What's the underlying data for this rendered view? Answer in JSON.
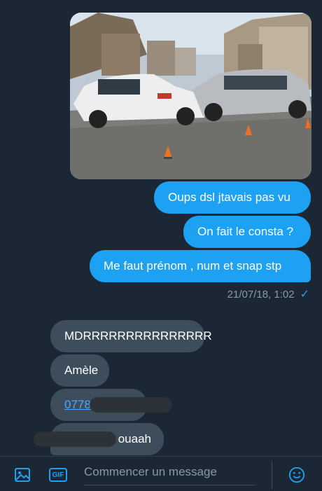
{
  "messages_out": [
    {
      "text": "Oups dsl jtavais pas vu"
    },
    {
      "text": "On fait le consta ?"
    },
    {
      "text": "Me faut prénom , num et snap stp"
    }
  ],
  "timestamp": "21/07/18, 1:02",
  "messages_in": [
    {
      "text": "MDRRRRRRRRRRRRRRR"
    },
    {
      "text": "Amèle"
    },
    {
      "text": "0778"
    },
    {
      "text": "ouaah"
    }
  ],
  "composer": {
    "placeholder": "Commencer un message",
    "gif_label": "GIF"
  },
  "colors": {
    "background": "#1b2734",
    "outgoing_bubble": "#1da1f2",
    "incoming_bubble": "#3d4d5c",
    "accent": "#1da1f2"
  },
  "icons": [
    "image-icon",
    "gif-icon",
    "emoji-icon",
    "read-check-icon"
  ]
}
